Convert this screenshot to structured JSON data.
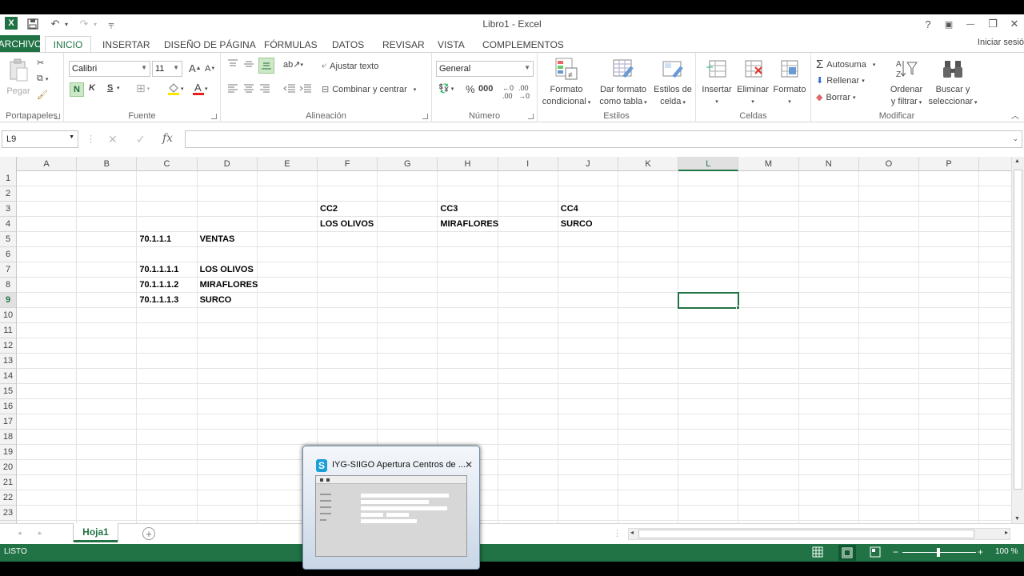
{
  "titlebar": {
    "title": "Libro1 - Excel",
    "logo_text": "X",
    "help": "?",
    "restore_ribbon": "▣",
    "minimize": "—",
    "maximize": "❐",
    "close": "✕"
  },
  "tabs": {
    "archivo": "ARCHIVO",
    "inicio": "INICIO",
    "insertar": "INSERTAR",
    "diseno": "DISEÑO DE PÁGINA",
    "formulas": "FÓRMULAS",
    "datos": "DATOS",
    "revisar": "REVISAR",
    "vista": "VISTA",
    "complementos": "COMPLEMENTOS",
    "signin": "Iniciar sesió"
  },
  "ribbon": {
    "clipboard": {
      "paste": "Pegar",
      "label": "Portapapeles"
    },
    "font": {
      "name": "Calibri",
      "size": "11",
      "bold": "N",
      "italic": "K",
      "underline": "S",
      "label": "Fuente"
    },
    "alignment": {
      "wrap": "Ajustar texto",
      "merge": "Combinar y centrar",
      "label": "Alineación"
    },
    "number": {
      "format": "General",
      "label": "Número"
    },
    "styles": {
      "conditional": [
        "Formato",
        "condicional"
      ],
      "table": [
        "Dar formato",
        "como tabla"
      ],
      "cell_styles": [
        "Estilos de",
        "celda"
      ],
      "label": "Estilos"
    },
    "cells": {
      "insert": "Insertar",
      "delete": "Eliminar",
      "format": "Formato",
      "label": "Celdas"
    },
    "editing": {
      "autosum": "Autosuma",
      "fill": "Rellenar",
      "clear": "Borrar",
      "sort": [
        "Ordenar",
        "y filtrar"
      ],
      "find": [
        "Buscar y",
        "seleccionar"
      ],
      "label": "Modificar"
    }
  },
  "formula_bar": {
    "name_box": "L9",
    "fx": "fx",
    "value": ""
  },
  "columns": [
    "A",
    "B",
    "C",
    "D",
    "E",
    "F",
    "G",
    "H",
    "I",
    "J",
    "K",
    "L",
    "M",
    "N",
    "O",
    "P"
  ],
  "rows": [
    "1",
    "2",
    "3",
    "4",
    "5",
    "6",
    "7",
    "8",
    "9",
    "10",
    "11",
    "12",
    "13",
    "14",
    "15",
    "16",
    "17",
    "18",
    "19",
    "20",
    "21",
    "22",
    "23"
  ],
  "selected": {
    "column": "L",
    "row": "9"
  },
  "cells": {
    "F3": "CC2",
    "H3": "CC3",
    "J3": "CC4",
    "F4": "LOS OLIVOS",
    "H4": "MIRAFLORES",
    "J4": "SURCO",
    "C5": "70.1.1.1",
    "D5": "VENTAS",
    "C7": "70.1.1.1.1",
    "D7": "LOS OLIVOS",
    "C8": "70.1.1.1.2",
    "D8": "MIRAFLORES",
    "C9": "70.1.1.1.3",
    "D9": "SURCO"
  },
  "sheets": {
    "active": "Hoja1"
  },
  "status": {
    "mode": "LISTO",
    "zoom": "100 %"
  },
  "preview": {
    "icon": "S",
    "title": "IYG-SIIGO Apertura Centros de ..."
  }
}
